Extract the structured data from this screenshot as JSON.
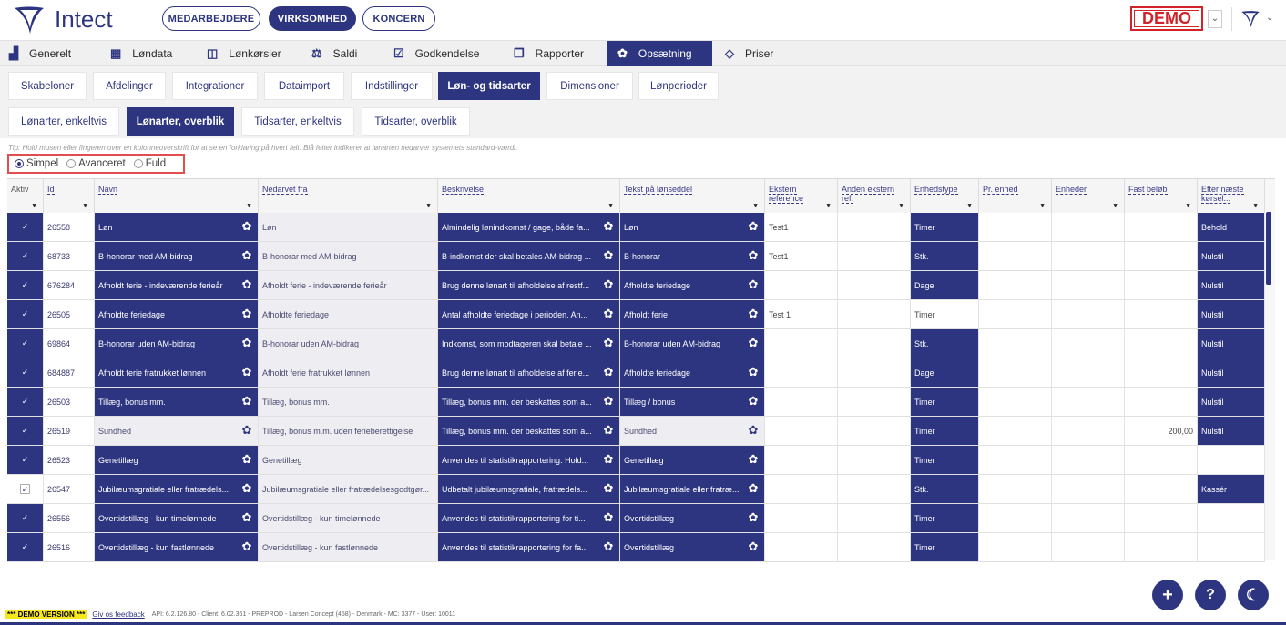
{
  "brand": {
    "name": "Intect"
  },
  "context_pills": [
    {
      "label": "MEDARBEJDERE",
      "active": false
    },
    {
      "label": "VIRKSOMHED",
      "active": true
    },
    {
      "label": "KONCERN",
      "active": false
    }
  ],
  "demo_badge": "DEMO",
  "main_nav": [
    {
      "label": "Generelt",
      "icon": "chart-icon"
    },
    {
      "label": "Løndata",
      "icon": "grid-icon"
    },
    {
      "label": "Lønkørsler",
      "icon": "window-icon"
    },
    {
      "label": "Saldi",
      "icon": "scale-icon"
    },
    {
      "label": "Godkendelse",
      "icon": "calendar-check-icon"
    },
    {
      "label": "Rapporter",
      "icon": "copy-icon"
    },
    {
      "label": "Opsætning",
      "icon": "gear-icon",
      "active": true
    },
    {
      "label": "Priser",
      "icon": "diamond-icon"
    }
  ],
  "sub_tabs": [
    {
      "label": "Skabeloner"
    },
    {
      "label": "Afdelinger"
    },
    {
      "label": "Integrationer"
    },
    {
      "label": "Dataimport"
    },
    {
      "label": "Indstillinger"
    },
    {
      "label": "Løn- og tidsarter",
      "active": true
    },
    {
      "label": "Dimensioner"
    },
    {
      "label": "Lønperioder"
    }
  ],
  "sub_tabs2": [
    {
      "label": "Lønarter, enkeltvis"
    },
    {
      "label": "Lønarter, overblik",
      "active": true
    },
    {
      "label": "Tidsarter, enkeltvis"
    },
    {
      "label": "Tidsarter, overblik"
    }
  ],
  "tip": "Tip: Hold musen eller fingeren over en kolonneoverskrift for at se en forklaring på hvert felt. Blå felter indikerer at lønarten nedarver systemets standard-værdi.",
  "view_modes": [
    {
      "label": "Simpel",
      "selected": true
    },
    {
      "label": "Avanceret",
      "selected": false
    },
    {
      "label": "Fuld",
      "selected": false
    }
  ],
  "columns": [
    "Aktiv",
    "Id",
    "Navn",
    "Nedarvet fra",
    "Beskrivelse",
    "Tekst på lønseddel",
    "Ekstern reference",
    "Anden ekstern ref.",
    "Enhedstype",
    "Pr. enhed",
    "Enheder",
    "Fast beløb",
    "Efter næste kørsel..."
  ],
  "rows": [
    {
      "active": true,
      "id": "26558",
      "name": "Løn",
      "inherited": "Løn",
      "desc": "Almindelig lønindkomst / gage, både fa...",
      "payslip": "Løn",
      "ext": "Test1",
      "unit": "Timer",
      "amount": "",
      "after": "Behold",
      "name_std": false,
      "pay_std": false,
      "unit_std": false
    },
    {
      "active": true,
      "id": "68733",
      "name": "B-honorar med AM-bidrag",
      "inherited": "B-honorar med AM-bidrag",
      "desc": "B-indkomst der skal betales AM-bidrag ...",
      "payslip": "B-honorar",
      "ext": "Test1",
      "unit": "Stk.",
      "amount": "",
      "after": "Nulstil",
      "name_std": false,
      "pay_std": false,
      "unit_std": false
    },
    {
      "active": true,
      "id": "676284",
      "name": "Afholdt ferie - indeværende ferieår",
      "inherited": "Afholdt ferie - indeværende ferieår",
      "desc": "Brug denne lønart til afholdelse af restf...",
      "payslip": "Afholdte feriedage",
      "ext": "",
      "unit": "Dage",
      "amount": "",
      "after": "Nulstil",
      "name_std": false,
      "pay_std": false,
      "unit_std": false
    },
    {
      "active": true,
      "id": "26505",
      "name": "Afholdte feriedage",
      "inherited": "Afholdte feriedage",
      "desc": "Antal afholdte feriedage i perioden. An...",
      "payslip": "Afholdt ferie",
      "ext": "Test 1",
      "unit": "Timer",
      "amount": "",
      "after": "Nulstil",
      "name_std": false,
      "pay_std": false,
      "unit_std": true
    },
    {
      "active": true,
      "id": "69864",
      "name": "B-honorar uden AM-bidrag",
      "inherited": "B-honorar uden AM-bidrag",
      "desc": "Indkomst, som modtageren skal betale ...",
      "payslip": "B-honorar uden AM-bidrag",
      "ext": "",
      "unit": "Stk.",
      "amount": "",
      "after": "Nulstil",
      "name_std": false,
      "pay_std": false,
      "unit_std": false
    },
    {
      "active": true,
      "id": "684887",
      "name": "Afholdt ferie fratrukket lønnen",
      "inherited": "Afholdt ferie fratrukket lønnen",
      "desc": "Brug denne lønart til afholdelse af ferie...",
      "payslip": "Afholdte feriedage",
      "ext": "",
      "unit": "Dage",
      "amount": "",
      "after": "Nulstil",
      "name_std": false,
      "pay_std": false,
      "unit_std": false
    },
    {
      "active": true,
      "id": "26503",
      "name": "Tillæg, bonus mm.",
      "inherited": "Tillæg, bonus mm.",
      "desc": "Tillæg, bonus mm. der beskattes som a...",
      "payslip": "Tillæg / bonus",
      "ext": "",
      "unit": "Timer",
      "amount": "",
      "after": "Nulstil",
      "name_std": false,
      "pay_std": false,
      "unit_std": false
    },
    {
      "active": true,
      "id": "26519",
      "name": "Sundhed",
      "inherited": "Tillæg, bonus m.m. uden ferieberettigelse",
      "desc": "Tillæg, bonus mm. der beskattes som a...",
      "payslip": "Sundhed",
      "ext": "",
      "unit": "Timer",
      "amount": "200,00",
      "after": "Nulstil",
      "name_std": true,
      "pay_std": true,
      "unit_std": false
    },
    {
      "active": true,
      "id": "26523",
      "name": "Genetillæg",
      "inherited": "Genetillæg",
      "desc": "Anvendes til statistikrapportering. Hold...",
      "payslip": "Genetillæg",
      "ext": "",
      "unit": "Timer",
      "amount": "",
      "after": "",
      "name_std": false,
      "pay_std": false,
      "unit_std": false
    },
    {
      "active": false,
      "id": "26547",
      "name": "Jubilæumsgratiale eller fratrædels...",
      "inherited": "Jubilæumsgratiale eller fratrædelsesgodtgør...",
      "desc": "Udbetalt jubilæumsgratiale, fratrædels...",
      "payslip": "Jubilæumsgratiale eller fratræ...",
      "ext": "",
      "unit": "Stk.",
      "amount": "",
      "after": "Kassér",
      "name_std": false,
      "pay_std": false,
      "unit_std": false
    },
    {
      "active": true,
      "id": "26556",
      "name": "Overtidstillæg - kun timelønnede",
      "inherited": "Overtidstillæg - kun timelønnede",
      "desc": "Anvendes til statistikrapportering for ti...",
      "payslip": "Overtidstillæg",
      "ext": "",
      "unit": "Timer",
      "amount": "",
      "after": "",
      "name_std": false,
      "pay_std": false,
      "unit_std": false
    },
    {
      "active": true,
      "id": "26516",
      "name": "Overtidstillæg - kun fastlønnede",
      "inherited": "Overtidstillæg - kun fastlønnede",
      "desc": "Anvendes til statistikrapportering for fa...",
      "payslip": "Overtidstillæg",
      "ext": "",
      "unit": "Timer",
      "amount": "",
      "after": "",
      "name_std": false,
      "pay_std": false,
      "unit_std": false
    }
  ],
  "footer": {
    "demo": "*** DEMO VERSION ***",
    "feedback": "Giv os feedback",
    "info": "API: 6.2.126.80 - Client: 6.02.361 - PREPROD - Larsen Concept (458) - Denmark - MC: 3377 - User: 10011"
  },
  "colors": {
    "primary": "#2d3580",
    "demo": "#d2232a"
  }
}
